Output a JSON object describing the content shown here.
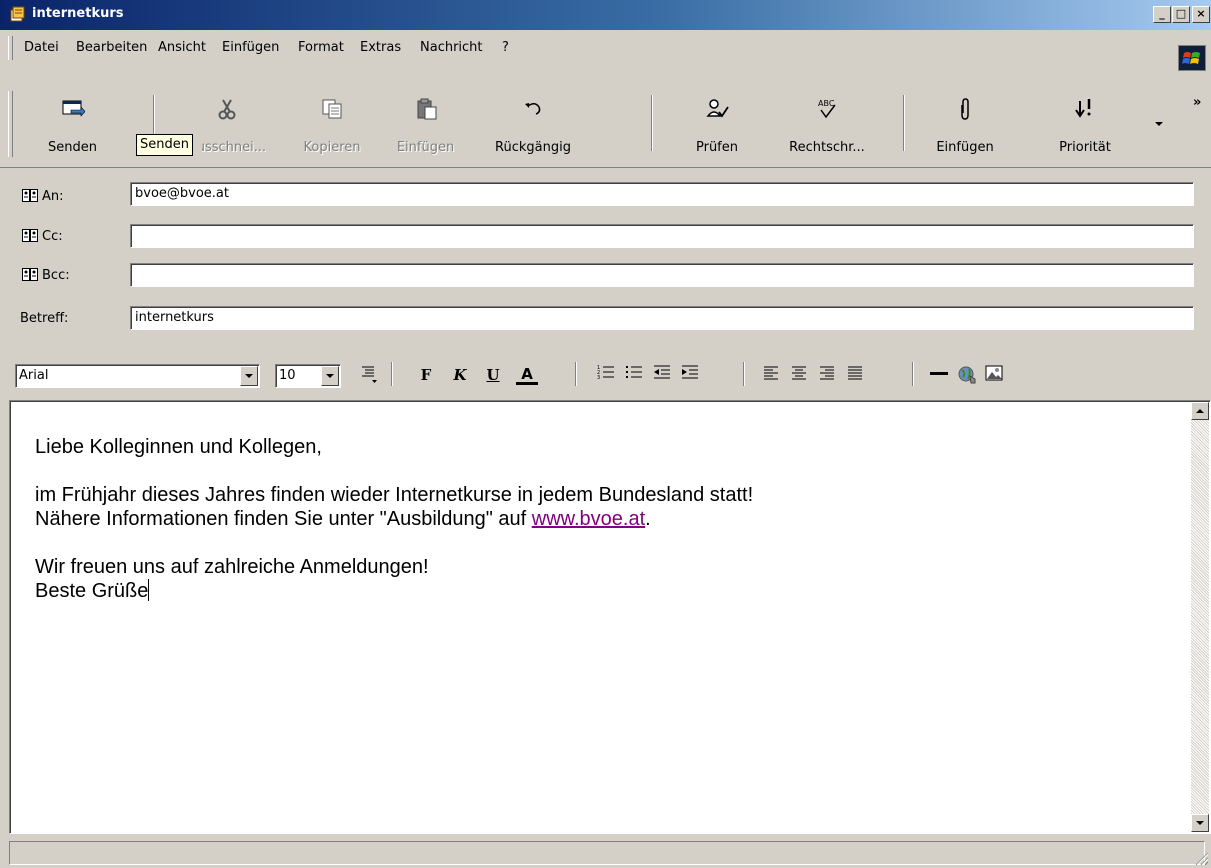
{
  "window": {
    "title": "internetkurs",
    "controls": {
      "minimize": "_",
      "maximize": "□",
      "close": "×"
    }
  },
  "menu": {
    "items": [
      "Datei",
      "Bearbeiten",
      "Ansicht",
      "Einfügen",
      "Format",
      "Extras",
      "Nachricht",
      "?"
    ]
  },
  "toolbar": {
    "buttons": [
      {
        "label": "Senden",
        "icon": "send-icon",
        "enabled": true
      },
      {
        "label": "Ausschnei...",
        "icon": "scissors-icon",
        "enabled": false
      },
      {
        "label": "Kopieren",
        "icon": "copy-icon",
        "enabled": false
      },
      {
        "label": "Einfügen",
        "icon": "paste-icon",
        "enabled": false
      },
      {
        "label": "Rückgängig",
        "icon": "undo-icon",
        "enabled": true
      },
      {
        "label": "Prüfen",
        "icon": "check-names-icon",
        "enabled": true
      },
      {
        "label": "Rechtschr...",
        "icon": "spelling-icon",
        "enabled": true
      },
      {
        "label": "Einfügen",
        "icon": "paperclip-icon",
        "enabled": true
      },
      {
        "label": "Priorität",
        "icon": "priority-icon",
        "enabled": true
      }
    ],
    "tooltip": "Senden",
    "more": "»"
  },
  "header": {
    "to": {
      "label": "An:",
      "value": "bvoe@bvoe.at"
    },
    "cc": {
      "label": "Cc:",
      "value": ""
    },
    "bcc": {
      "label": "Bcc:",
      "value": ""
    },
    "subject": {
      "label": "Betreff:",
      "value": "internetkurs"
    }
  },
  "format": {
    "font": "Arial",
    "size": "10",
    "buttons": {
      "bold": "F",
      "italic": "K",
      "underline": "U",
      "color": "A"
    }
  },
  "message": {
    "greeting": "Liebe Kolleginnen und Kollegen,",
    "line1": "im Frühjahr dieses Jahres finden wieder Internetkurse in jedem Bundesland statt!",
    "line2_before": "Nähere Informationen finden Sie unter \"Ausbildung\" auf ",
    "link": "www.bvoe.at",
    "line2_after": ".",
    "line3": "Wir freuen uns auf zahlreiche Anmeldungen!",
    "line4": "Beste Grüße"
  },
  "colors": {
    "title_start": "#0a246a",
    "title_end": "#a6caf0",
    "chrome": "#d4d0c8",
    "link": "#800080"
  }
}
